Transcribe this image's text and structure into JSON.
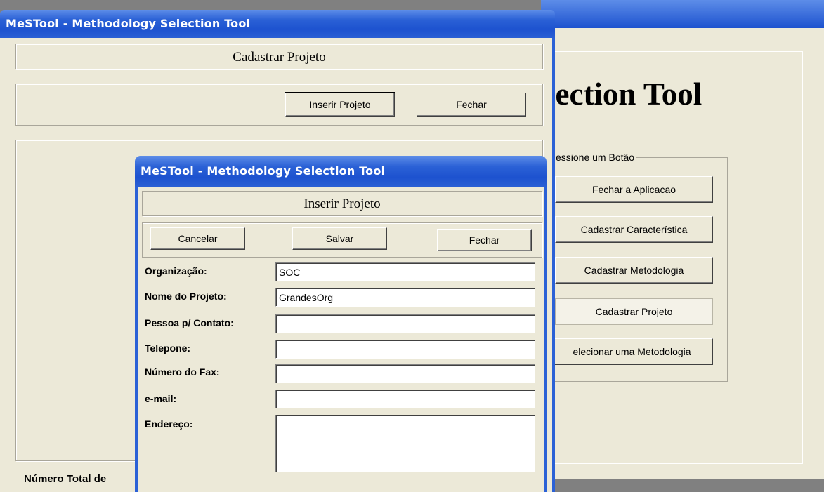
{
  "main_window": {
    "heading_partial": "lection Tool",
    "group_title": "essione um Botão",
    "buttons": [
      "Fechar a Aplicacao",
      "Cadastrar Característica",
      "Cadastrar Metodologia",
      "Cadastrar Projeto",
      "elecionar uma Metodologia"
    ]
  },
  "cadastrar_window": {
    "title": "MeSTool - Methodology Selection Tool",
    "header": "Cadastrar Projeto",
    "insert_button": "Inserir Projeto",
    "close_button": "Fechar",
    "footer_label": "Número Total de"
  },
  "inserir_window": {
    "title": "MeSTool - Methodology Selection Tool",
    "header": "Inserir Projeto",
    "cancel_button": "Cancelar",
    "save_button": "Salvar",
    "close_button": "Fechar",
    "fields": {
      "organizacao": {
        "label": "Organização:",
        "value": "SOC"
      },
      "nome_projeto": {
        "label": "Nome do Projeto:",
        "value": "GrandesOrg"
      },
      "pessoa_contato": {
        "label": "Pessoa p/ Contato:",
        "value": ""
      },
      "telefone": {
        "label": "Telepone:",
        "value": ""
      },
      "fax": {
        "label": "Número do Fax:",
        "value": ""
      },
      "email": {
        "label": "e-mail:",
        "value": ""
      },
      "endereco": {
        "label": "Endereço:",
        "value": ""
      }
    }
  }
}
